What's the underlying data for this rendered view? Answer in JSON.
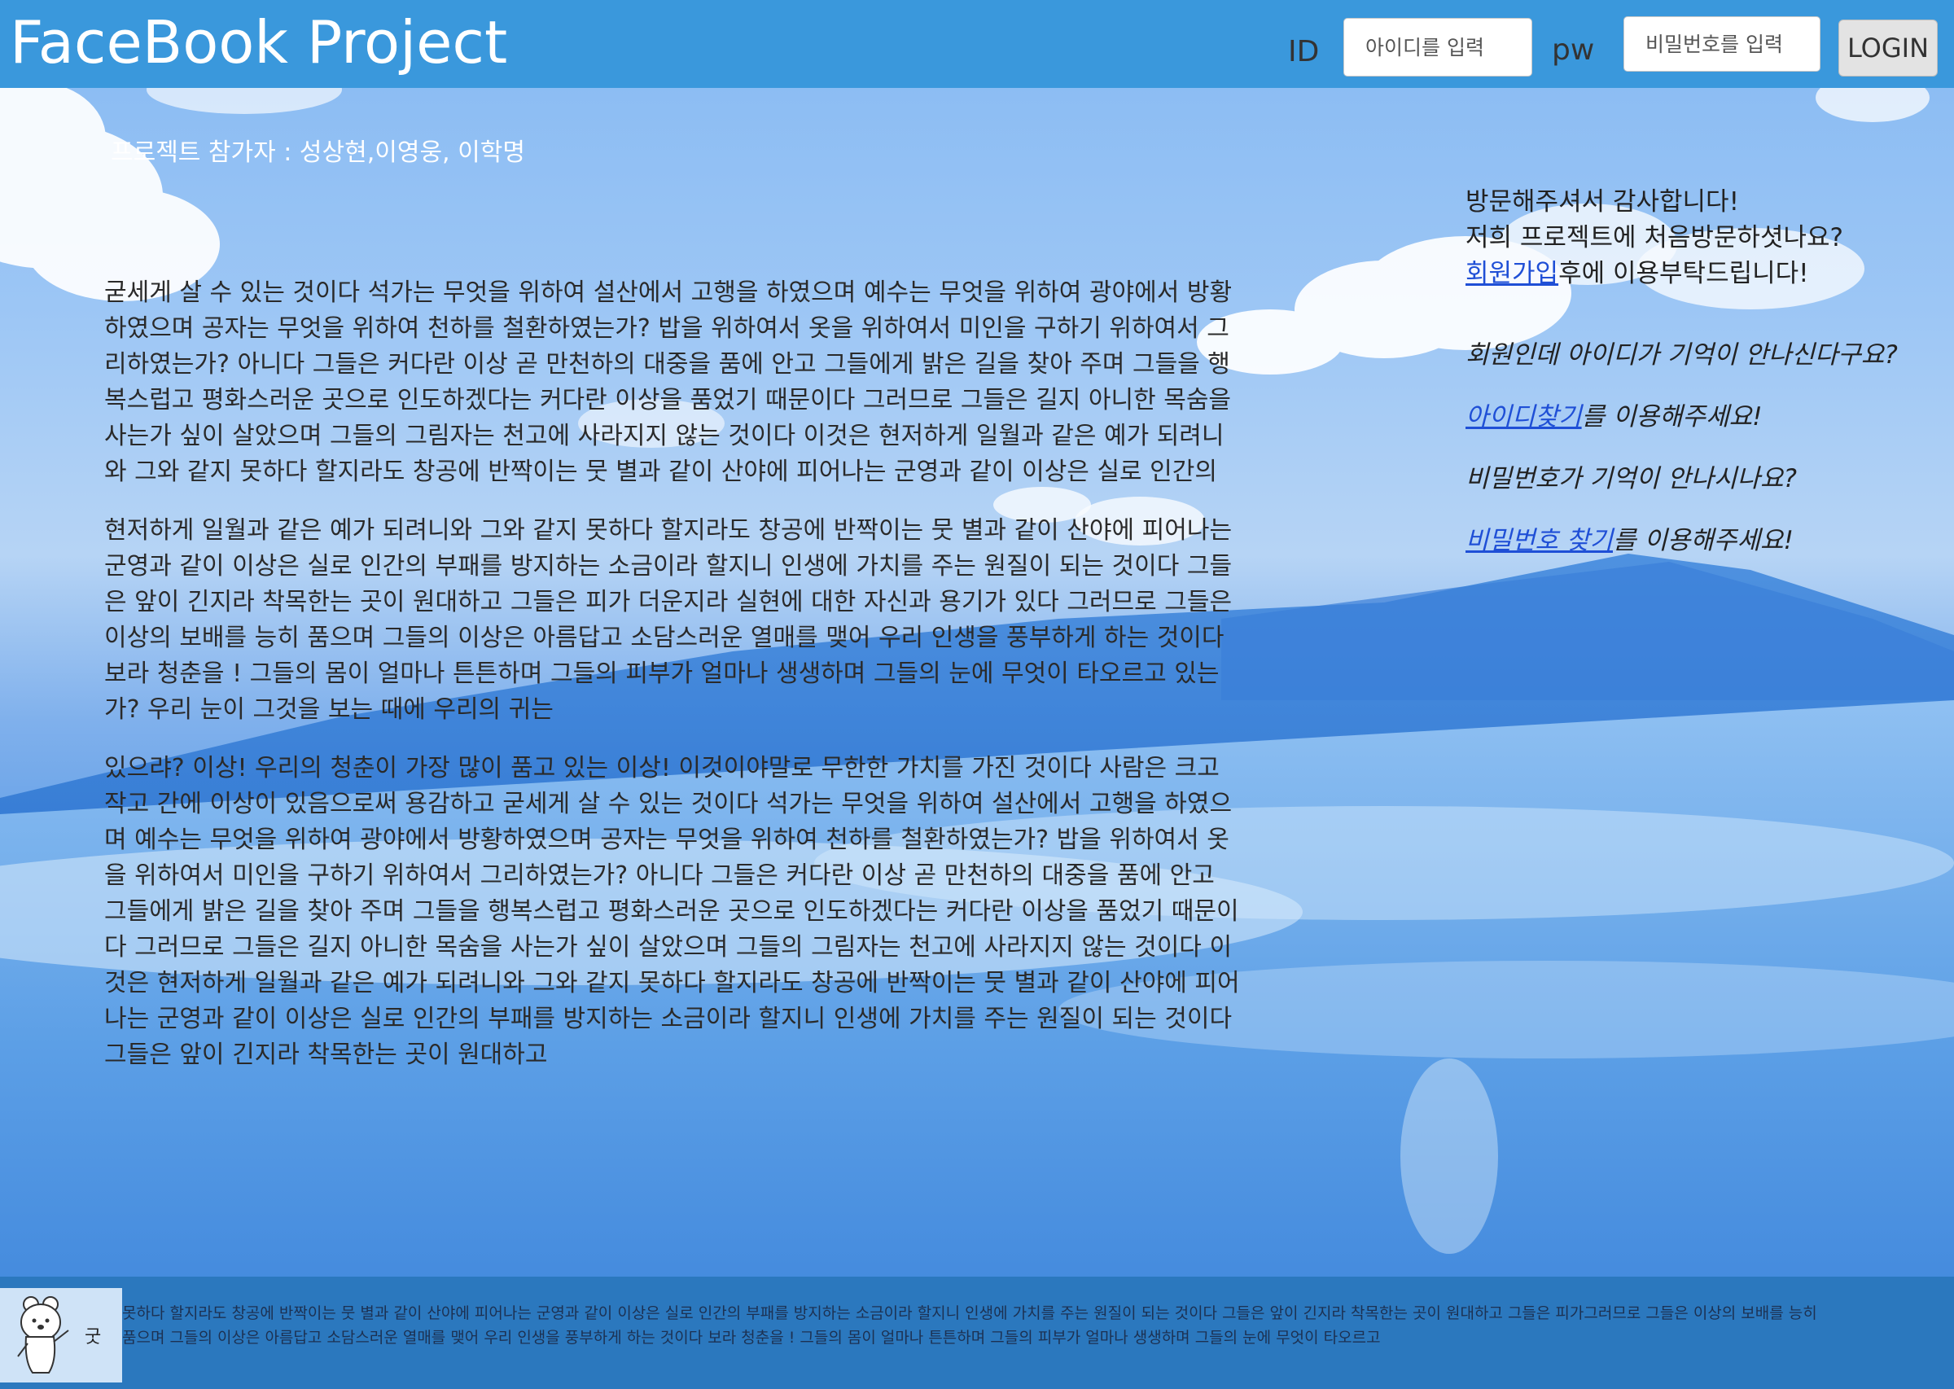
{
  "header": {
    "brand": "FaceBook Project",
    "id_label": "ID",
    "id_placeholder": "아이디를 입력",
    "pw_label": "pw",
    "pw_placeholder": "비밀번호를 입력",
    "login_label": "LOGIN"
  },
  "main": {
    "participants": "프로젝트 참가자 : 성상현,이영웅, 이학명",
    "paragraphs": [
      "굳세게 살 수 있는 것이다 석가는 무엇을 위하여 설산에서 고행을 하였으며 예수는 무엇을 위하여 광야에서 방황하였으며 공자는 무엇을 위하여 천하를 철환하였는가? 밥을 위하여서 옷을 위하여서 미인을 구하기 위하여서 그리하였는가? 아니다 그들은 커다란 이상 곧 만천하의 대중을 품에 안고 그들에게 밝은 길을 찾아 주며 그들을 행복스럽고 평화스러운 곳으로 인도하겠다는 커다란 이상을 품었기 때문이다 그러므로 그들은 길지 아니한 목숨을 사는가 싶이 살았으며 그들의 그림자는 천고에 사라지지 않는 것이다 이것은 현저하게 일월과 같은 예가 되려니와 그와 같지 못하다 할지라도 창공에 반짝이는 뭇 별과 같이 산야에 피어나는 군영과 같이 이상은 실로 인간의",
      "현저하게 일월과 같은 예가 되려니와 그와 같지 못하다 할지라도 창공에 반짝이는 뭇 별과 같이 산야에 피어나는 군영과 같이 이상은 실로 인간의 부패를 방지하는 소금이라 할지니 인생에 가치를 주는 원질이 되는 것이다 그들은 앞이 긴지라 착목한는 곳이 원대하고 그들은 피가 더운지라 실현에 대한 자신과 용기가 있다 그러므로 그들은 이상의 보배를 능히 품으며 그들의 이상은 아름답고 소담스러운 열매를 맺어 우리 인생을 풍부하게 하는 것이다 보라 청춘을 ! 그들의 몸이 얼마나 튼튼하며 그들의 피부가 얼마나 생생하며 그들의 눈에 무엇이 타오르고 있는가? 우리 눈이 그것을 보는 때에 우리의 귀는",
      "있으랴? 이상! 우리의 청춘이 가장 많이 품고 있는 이상! 이것이야말로 무한한 가치를 가진 것이다 사람은 크고 작고 간에 이상이 있음으로써 용감하고 굳세게 살 수 있는 것이다 석가는 무엇을 위하여 설산에서 고행을 하였으며 예수는 무엇을 위하여 광야에서 방황하였으며 공자는 무엇을 위하여 천하를 철환하였는가? 밥을 위하여서 옷을 위하여서 미인을 구하기 위하여서 그리하였는가? 아니다 그들은 커다란 이상 곧 만천하의 대중을 품에 안고 그들에게 밝은 길을 찾아 주며 그들을 행복스럽고 평화스러운 곳으로 인도하겠다는 커다란 이상을 품었기 때문이다 그러므로 그들은 길지 아니한 목숨을 사는가 싶이 살았으며 그들의 그림자는 천고에 사라지지 않는 것이다 이것은 현저하게 일월과 같은 예가 되려니와 그와 같지 못하다 할지라도 창공에 반짝이는 뭇 별과 같이 산야에 피어나는 군영과 같이 이상은 실로 인간의 부패를 방지하는 소금이라 할지니 인생에 가치를 주는 원질이 되는 것이다 그들은 앞이 긴지라 착목한는 곳이 원대하고"
    ]
  },
  "aside": {
    "welcome_1": "방문해주셔서 감사합니다!",
    "welcome_2": "저희 프로젝트에 처음방문하셧나요?",
    "signup_link": "회원가입",
    "signup_suffix": "후에 이용부탁드립니다!",
    "forgot_id": "회원인데 아이디가 기억이 안나신다구요?",
    "find_id_link": "아이디찾기",
    "find_id_suffix": "를 이용해주세요!",
    "forgot_pw": "비밀번호가 기억이 안나시나요?",
    "find_pw_link": "비밀번호 찾기",
    "find_pw_suffix": "를 이용해주세요!"
  },
  "footer": {
    "logo_text": "굿",
    "text": "못하다 할지라도 창공에 반짝이는 뭇 별과 같이 산야에 피어나는 군영과 같이 이상은 실로 인간의 부패를 방지하는 소금이라 할지니 인생에 가치를 주는 원질이 되는 것이다 그들은 앞이 긴지라 착목한는 곳이 원대하고 그들은 피가그러므로 그들은 이상의 보배를 능히 품으며 그들의 이상은 아름답고 소담스러운 열매를 맺어 우리 인생을 풍부하게 하는 것이다 보라 청춘을 ! 그들의 몸이 얼마나 튼튼하며 그들의 피부가 얼마나 생생하며 그들의 눈에 무엇이 타오르고"
  }
}
